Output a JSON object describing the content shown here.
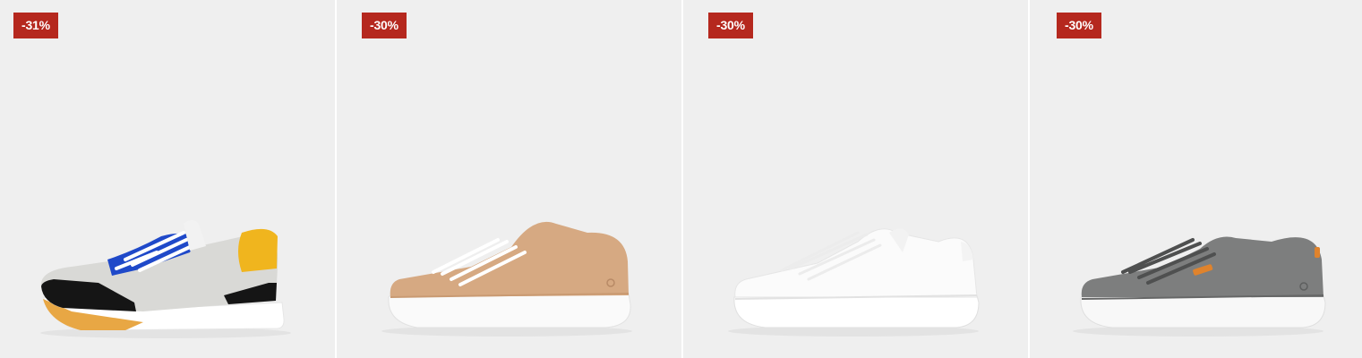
{
  "products": [
    {
      "badge": "-31%",
      "icon": "sneaker-multicolor-icon",
      "colors": {
        "upper": "#d9d9d6",
        "accent": "#1f49c9",
        "heel": "#f0b51e",
        "panel": "#151515",
        "sole": "#e8a744"
      }
    },
    {
      "badge": "-30%",
      "icon": "sneaker-beige-icon",
      "colors": {
        "upper": "#d6a982",
        "sole": "#fafafa"
      }
    },
    {
      "badge": "-30%",
      "icon": "sneaker-white-icon",
      "colors": {
        "upper": "#fbfbfb",
        "sole": "#ffffff"
      }
    },
    {
      "badge": "-30%",
      "icon": "sneaker-grey-icon",
      "colors": {
        "upper": "#7d7e7e",
        "tab": "#e0832c",
        "sole": "#f8f8f8"
      }
    }
  ],
  "colors": {
    "badge_bg": "#b5281e",
    "badge_text": "#ffffff",
    "card_bg": "#efefef"
  }
}
